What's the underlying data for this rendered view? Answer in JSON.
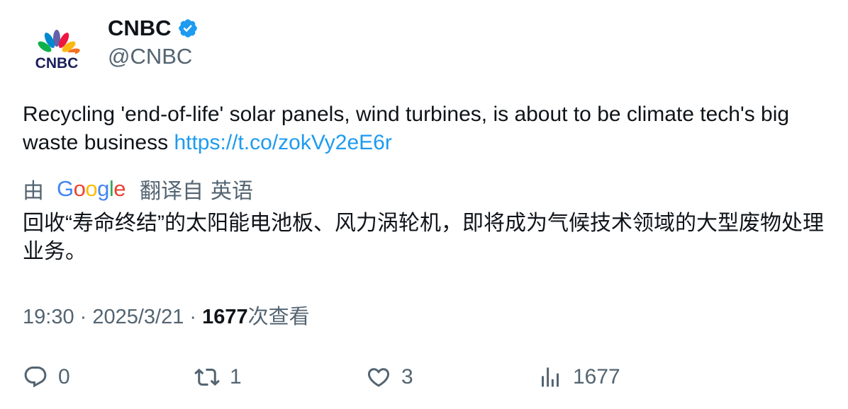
{
  "author": {
    "display_name": "CNBC",
    "handle": "@CNBC",
    "verified": true,
    "avatar_logo_text": "CNBC"
  },
  "tweet": {
    "text": "Recycling 'end-of-life' solar panels, wind turbines, is about to be climate tech's big waste business ",
    "link": "https://t.co/zokVy2eE6r"
  },
  "translation": {
    "by": "由",
    "provider": "Google",
    "from_label": "翻译自",
    "language": "英语",
    "text": "回收“寿命终结”的太阳能电池板、风力涡轮机，即将成为气候技术领域的大型废物处理业务。"
  },
  "meta": {
    "time": "19:30",
    "date": "2025/3/21",
    "separator": " · ",
    "views_count": "1677",
    "views_label": "次查看"
  },
  "actions": {
    "reply_count": "0",
    "retweet_count": "1",
    "like_count": "3",
    "view_count": "1677"
  },
  "colors": {
    "link": "#1d9bf0",
    "verified": "#1d9bf0",
    "secondary_text": "#536471",
    "primary_text": "#0f1419"
  },
  "icons": [
    "cnbc-peacock-logo",
    "verified-badge-icon",
    "reply-icon",
    "retweet-icon",
    "like-icon",
    "views-icon"
  ]
}
